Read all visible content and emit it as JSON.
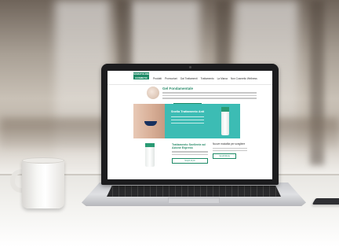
{
  "site": {
    "logo_text": "SOMATOLINE COSMETIC",
    "nav": [
      "Prodotti",
      "Promozioni",
      "Dai Trattamenti",
      "Trattamento",
      "La Marca",
      "Non Cosmetic Wellness"
    ],
    "hero_title": "Gel Fondamentale",
    "hero_button": "Scopri di più",
    "band_title": "Snella Trattamento Anti",
    "product_title": "Trattamento Snellente ad Azione Express",
    "product_button": "Scopri di più",
    "side_title": "Nuove modalità per scegliere",
    "side_button": "Vai all'offerta"
  },
  "colors": {
    "brand_green": "#1d8a66",
    "band_teal": "#3cbcb4",
    "laptop_bezel": "#1c1c1e"
  }
}
